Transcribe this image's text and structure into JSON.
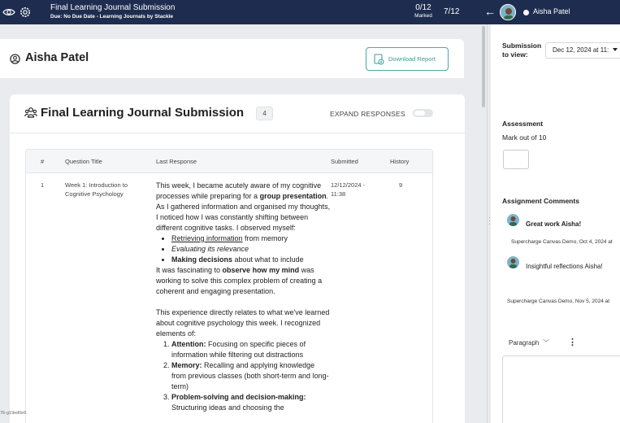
{
  "topbar": {
    "title": "Final Learning Journal Submission",
    "subtitle": "Due: No Due Date - Learning Journals by Stackle",
    "marked_count": "0/12",
    "marked_label": "Marked",
    "position": "7/12",
    "student_name": "Aisha Patel"
  },
  "student": {
    "name": "Aisha Patel",
    "download_label": "Download Report"
  },
  "submission": {
    "title": "Final Learning Journal Submission",
    "count": "4",
    "expand_label": "EXPAND RESPONSES",
    "expanded": false
  },
  "table": {
    "headers": [
      "#",
      "Question Title",
      "Last Response",
      "Submitted",
      "History"
    ],
    "row": {
      "num": "1",
      "question_line1": "Week 1: Introduction to",
      "question_line2": "Cognitive Psychology",
      "submitted_line1": "12/12/2024 -",
      "submitted_line2": "11:38",
      "history": "9"
    }
  },
  "response": {
    "p1_a": "This week, I became acutely aware of my cognitive processes while preparing for a ",
    "p1_b": "group presentation",
    "p1_c": ". As I gathered information and organised my thoughts, I noticed how I was constantly shifting between different cognitive tasks. I observed myself:",
    "b1_a": "Retrieving information",
    "b1_b": " from memory",
    "b2": "Evaluating its relevance",
    "b3_a": "Making decisions",
    "b3_b": " about what to include",
    "p2_a": "It was fascinating to ",
    "p2_b": "observe how my mind",
    "p2_c": " was working to solve this complex problem of creating a coherent and engaging presentation.",
    "p3": "This experience directly relates to what we've learned about cognitive psychology this week. I recognized elements of:",
    "o1_a": "Attention:",
    "o1_b": " Focusing on specific pieces of information while filtering out distractions",
    "o2_a": "Memory:",
    "o2_b": " Recalling and applying knowledge from previous classes (both short-term and long-term)",
    "o3_a": "Problem-solving and decision-making:",
    "o3_b": " Structuring ideas and choosing the"
  },
  "footer_version": "76-g19ed0e6",
  "right_panel": {
    "submission_label_1": "Submission",
    "submission_label_2": "to view:",
    "submission_value": "Dec 12, 2024 at 11:",
    "assessment_label": "Assessment",
    "mark_out_of": "Mark out of 10",
    "comments_label": "Assignment Comments",
    "comments": [
      {
        "text": "Great work Aisha!",
        "meta": "Supercharge Canvas Demo, Oct 4, 2024 at"
      },
      {
        "text": "Insightful reflections Aisha!",
        "meta": "Supercharge Canvas Demo, Nov 5, 2024 at"
      }
    ],
    "editor_format": "Paragraph"
  },
  "icons": [
    "eye-icon",
    "gear-icon",
    "back-arrow-icon",
    "user-circle-icon",
    "download-report-icon",
    "group-icon",
    "chevron-down-icon",
    "kebab-menu-icon",
    "drag-handle-icon"
  ],
  "colors": {
    "topbar": "#1e2d4f",
    "accent": "#49a8a5"
  }
}
